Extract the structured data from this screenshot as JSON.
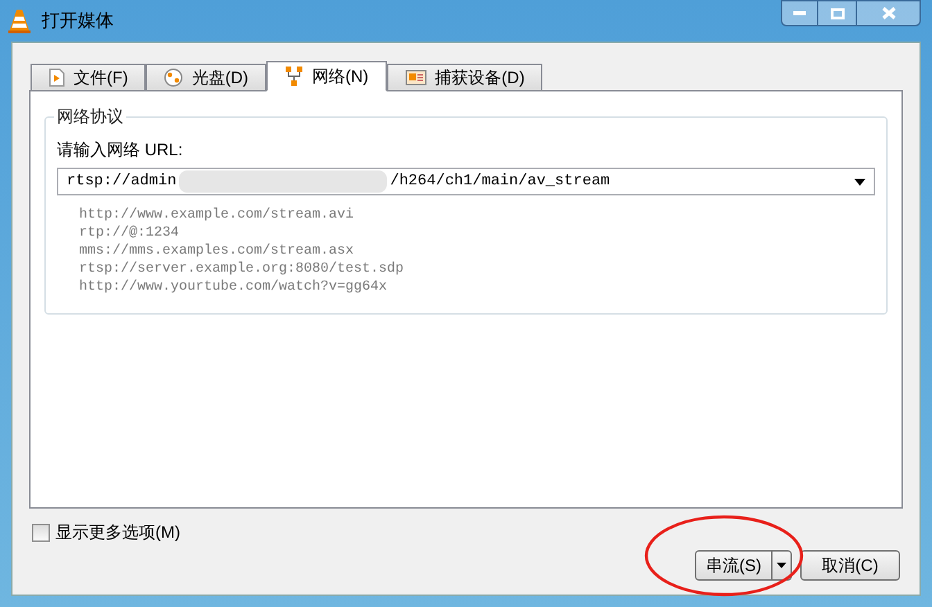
{
  "window": {
    "title": "打开媒体"
  },
  "tabs": [
    {
      "label": "文件(F)",
      "kind": "file",
      "selected": false
    },
    {
      "label": "光盘(D)",
      "kind": "disc",
      "selected": false
    },
    {
      "label": "网络(N)",
      "kind": "network",
      "selected": true
    },
    {
      "label": "捕获设备(D)",
      "kind": "capture",
      "selected": false
    }
  ],
  "network_protocol": {
    "group_title": "网络协议",
    "url_label": "请输入网络 URL:",
    "url_value_start": "rtsp://admin",
    "url_value_end": "/h264/ch1/main/av_stream",
    "examples": [
      "http://www.example.com/stream.avi",
      "rtp://@:1234",
      "mms://mms.examples.com/stream.asx",
      "rtsp://server.example.org:8080/test.sdp",
      "http://www.yourtube.com/watch?v=gg64x"
    ]
  },
  "show_more_options": {
    "label": "显示更多选项(M)",
    "checked": false
  },
  "buttons": [
    {
      "label": "串流(S)",
      "kind": "split"
    },
    {
      "label": "取消(C)",
      "kind": "plain"
    }
  ]
}
